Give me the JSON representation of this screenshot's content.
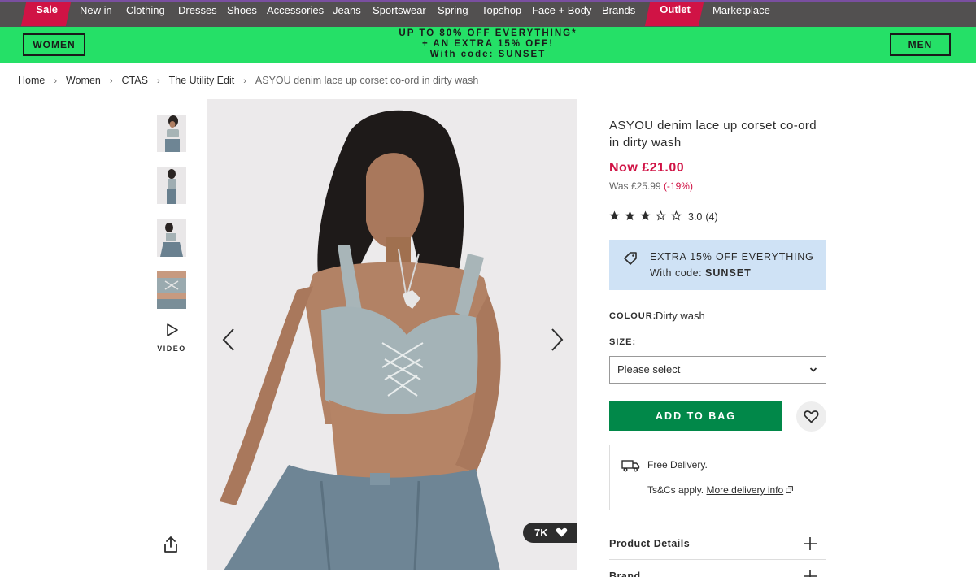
{
  "nav": {
    "items": [
      "Sale",
      "New in",
      "Clothing",
      "Dresses",
      "Shoes",
      "Accessories",
      "Jeans",
      "Sportswear",
      "Spring",
      "Topshop",
      "Face + Body",
      "Brands",
      "Outlet",
      "Marketplace"
    ]
  },
  "promo": {
    "women_label": "WOMEN",
    "men_label": "MEN",
    "line1": "UP TO 80% OFF EVERYTHING*",
    "line2": "+ AN EXTRA 15% OFF!",
    "line3": "With code: SUNSET"
  },
  "breadcrumb": [
    "Home",
    "Women",
    "CTAS",
    "The Utility Edit",
    "ASYOU denim lace up corset co-ord in dirty wash"
  ],
  "gallery": {
    "video_label": "VIDEO",
    "likes": "7K"
  },
  "product": {
    "title": "ASYOU denim lace up corset co-ord in dirty wash",
    "price_now": "Now £21.00",
    "price_was": "Was £25.99",
    "discount": "(-19%)",
    "rating_value": "3.0",
    "rating_count": "(4)",
    "rating_stars": 3,
    "offer_line1": "EXTRA 15% OFF EVERYTHING",
    "offer_line2_prefix": "With code:",
    "offer_code": "SUNSET",
    "colour_label": "COLOUR:",
    "colour_value": "Dirty wash",
    "size_label": "SIZE:",
    "size_placeholder": "Please select",
    "add_to_bag": "ADD TO BAG",
    "delivery_line1": "Free Delivery.",
    "delivery_line2_prefix": "Ts&Cs apply.",
    "delivery_link": "More delivery info",
    "accordion": [
      "Product Details",
      "Brand"
    ]
  },
  "colors": {
    "sale_red": "#d01345",
    "promo_green": "#25e067",
    "add_green": "#018849",
    "nav_bg": "#525050",
    "offer_blue": "#cfe2f5"
  }
}
